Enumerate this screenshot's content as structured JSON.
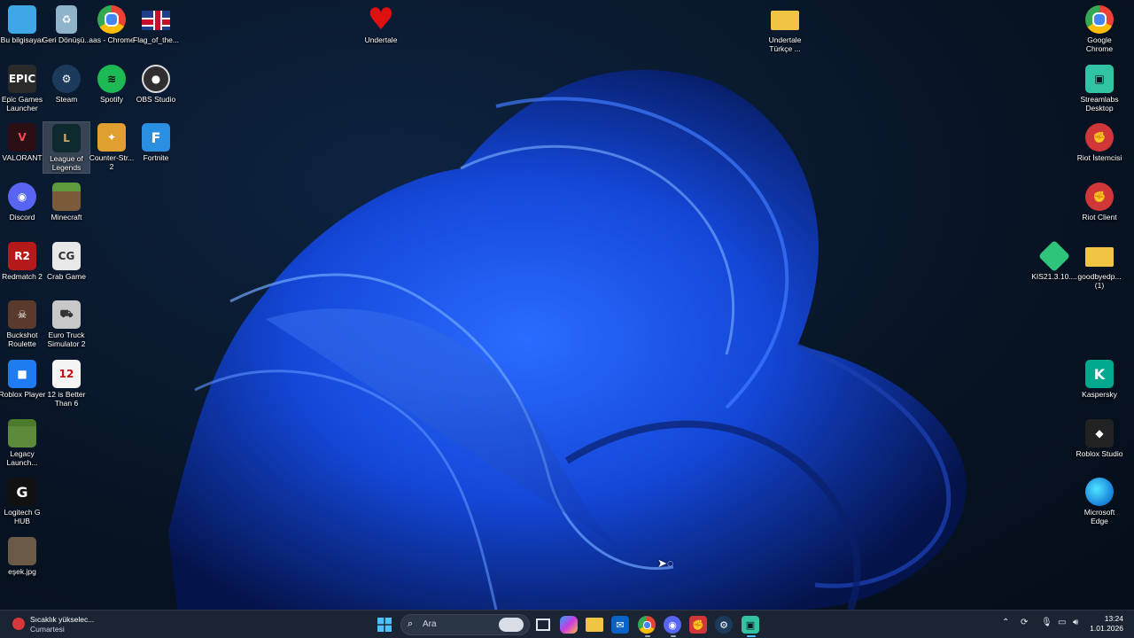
{
  "desktop_icons": [
    {
      "id": "bu-bilgisayar",
      "label": "Bu bilgisayar",
      "icon": "computer-icon",
      "color": "#3ea8e6"
    },
    {
      "id": "geri-donusum",
      "label": "Geri Dönüşü...",
      "icon": "recycle-bin-icon",
      "color": "#8fb3c9"
    },
    {
      "id": "aas-chrome",
      "label": "aas - Chrome",
      "icon": "chrome-icon",
      "color": "#34a853"
    },
    {
      "id": "flag",
      "label": "Flag_of_the...",
      "icon": "uk-flag-icon",
      "color": "#1d3e8a"
    },
    {
      "id": "undertale",
      "label": "Undertale",
      "icon": "heart-icon",
      "color": "#e01010"
    },
    {
      "id": "undertale-turkce",
      "label": "Undertale Türkçe ...",
      "icon": "folder-icon",
      "color": "#f1c544"
    },
    {
      "id": "google-chrome",
      "label": "Google Chrome",
      "icon": "chrome-icon",
      "color": "#34a853"
    },
    {
      "id": "epic",
      "label": "Epic Games Launcher",
      "icon": "epic-games-icon",
      "color": "#2a2a2a",
      "text": "EPIC"
    },
    {
      "id": "steam",
      "label": "Steam",
      "icon": "steam-icon",
      "color": "#1b3a5c"
    },
    {
      "id": "spotify",
      "label": "Spotify",
      "icon": "spotify-icon",
      "color": "#1db954"
    },
    {
      "id": "obs",
      "label": "OBS Studio",
      "icon": "obs-icon",
      "color": "#302e31"
    },
    {
      "id": "streamlabs",
      "label": "Streamlabs Desktop",
      "icon": "streamlabs-icon",
      "color": "#31c3a2"
    },
    {
      "id": "valorant",
      "label": "VALORANT",
      "icon": "valorant-icon",
      "color": "#2b0f14",
      "text": "V"
    },
    {
      "id": "lol",
      "label": "League of Legends",
      "icon": "league-icon",
      "color": "#0f2a2e",
      "text": "L"
    },
    {
      "id": "cs2",
      "label": "Counter-Str... 2",
      "icon": "counter-strike-icon",
      "color": "#e0a030"
    },
    {
      "id": "fortnite",
      "label": "Fortnite",
      "icon": "fortnite-icon",
      "color": "#2a8fe0",
      "text": "F"
    },
    {
      "id": "riot-istemci",
      "label": "Riot İstemcisi",
      "icon": "riot-icon",
      "color": "#d13639"
    },
    {
      "id": "discord",
      "label": "Discord",
      "icon": "discord-icon",
      "color": "#5865f2"
    },
    {
      "id": "minecraft",
      "label": "Minecraft",
      "icon": "minecraft-icon",
      "color": "#5d8a3a"
    },
    {
      "id": "riot-client",
      "label": "Riot Client",
      "icon": "riot-icon",
      "color": "#d13639"
    },
    {
      "id": "redmatch",
      "label": "Redmatch 2",
      "icon": "redmatch-icon",
      "color": "#b51a1a",
      "text": "R2"
    },
    {
      "id": "crab",
      "label": "Crab Game",
      "icon": "crab-game-icon",
      "color": "#e8e8e8",
      "text": "CG"
    },
    {
      "id": "kis",
      "label": "KIS21.3.10....",
      "icon": "kaspersky-installer-icon",
      "color": "#2ec47a"
    },
    {
      "id": "goodbye",
      "label": "goodbyedp... (1)",
      "icon": "folder-icon",
      "color": "#f1c544"
    },
    {
      "id": "buckshot",
      "label": "Buckshot Roulette",
      "icon": "buckshot-icon",
      "color": "#5a3a2a"
    },
    {
      "id": "ets2",
      "label": "Euro Truck Simulator 2",
      "icon": "truck-icon",
      "color": "#c8c8c8"
    },
    {
      "id": "roblox-player",
      "label": "Roblox Player",
      "icon": "roblox-icon",
      "color": "#1e7cf0"
    },
    {
      "id": "12better",
      "label": "12 is Better Than 6",
      "icon": "game-icon",
      "color": "#f4f4f4",
      "text": "12"
    },
    {
      "id": "kaspersky",
      "label": "Kaspersky",
      "icon": "kaspersky-icon",
      "color": "#00a88e",
      "text": "K"
    },
    {
      "id": "legacy",
      "label": "Legacy Launch...",
      "icon": "minecraft-icon",
      "color": "#5d8a3a"
    },
    {
      "id": "roblox-studio",
      "label": "Roblox Studio",
      "icon": "roblox-studio-icon",
      "color": "#222"
    },
    {
      "id": "logitech",
      "label": "Logitech G HUB",
      "icon": "logitech-icon",
      "color": "#111",
      "text": "G"
    },
    {
      "id": "edge",
      "label": "Microsoft Edge",
      "icon": "edge-icon",
      "color": "#1f8de0"
    },
    {
      "id": "esek",
      "label": "eşek.jpg",
      "icon": "image-file-icon",
      "color": "#6b5a48"
    }
  ],
  "taskbar": {
    "weather_line1": "Sıcaklık yükselec...",
    "weather_line2": "Cumartesi",
    "search_placeholder": "Ara",
    "apps": [
      "windows-start-icon",
      "file-explorer-icon",
      "task-view-icon",
      "copilot-icon",
      "folder-icon",
      "outlook-icon",
      "chrome-icon",
      "discord-icon",
      "riot-icon",
      "steam-icon",
      "streamlabs-icon"
    ],
    "tray_icons": [
      "chevron-up-icon",
      "sync-icon",
      "microphone-icon",
      "network-icon",
      "speaker-icon"
    ],
    "time": "13:24",
    "date": "1.01.2026"
  }
}
